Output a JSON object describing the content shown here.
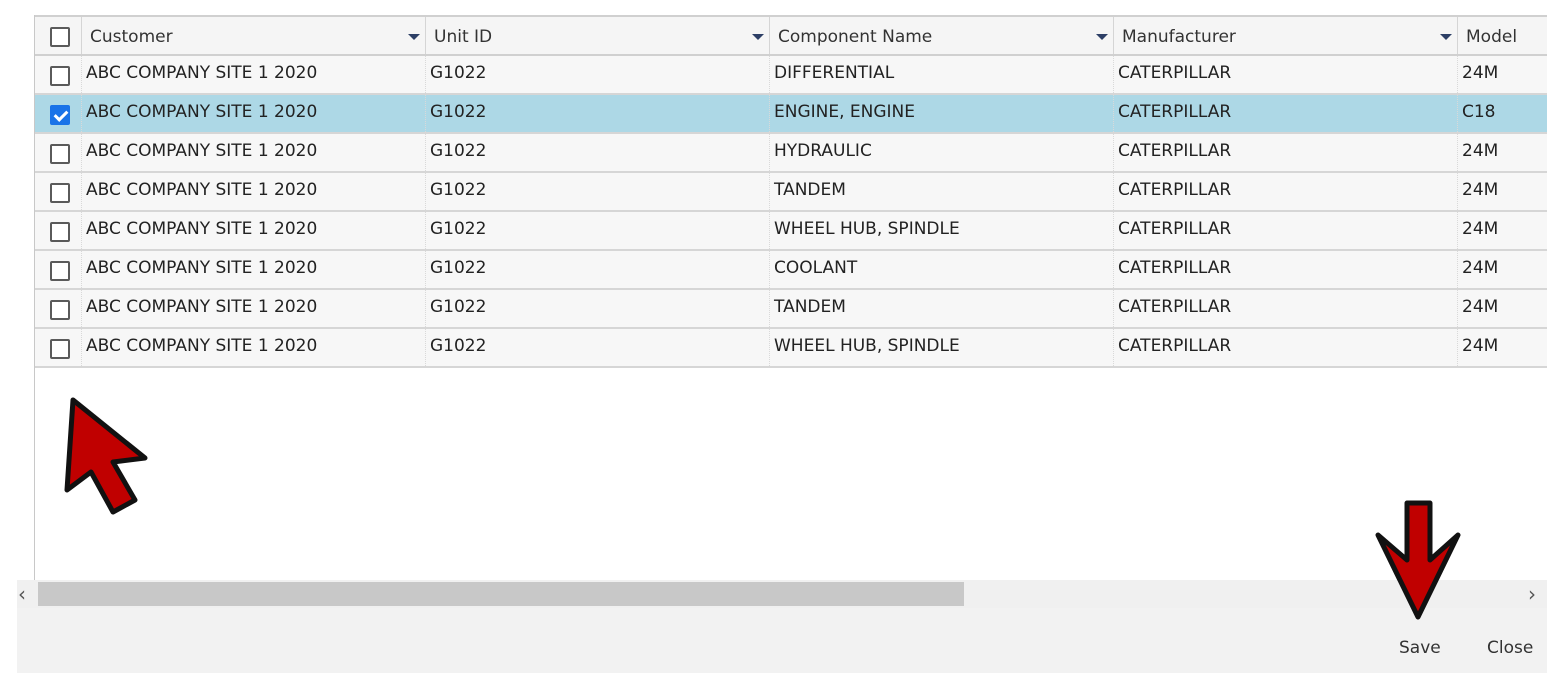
{
  "grid": {
    "columns": [
      {
        "key": "customer",
        "label": "Customer"
      },
      {
        "key": "unit_id",
        "label": "Unit ID"
      },
      {
        "key": "component",
        "label": "Component Name"
      },
      {
        "key": "manufacturer",
        "label": "Manufacturer"
      },
      {
        "key": "model",
        "label": "Model"
      }
    ],
    "rows": [
      {
        "customer": "ABC COMPANY SITE 1 2020",
        "unit_id": "G1022",
        "component": "DIFFERENTIAL",
        "manufacturer": "CATERPILLAR",
        "model": "24M",
        "checked": false
      },
      {
        "customer": "ABC COMPANY SITE 1 2020",
        "unit_id": "G1022",
        "component": "ENGINE, ENGINE",
        "manufacturer": "CATERPILLAR",
        "model": "C18",
        "checked": true
      },
      {
        "customer": "ABC COMPANY SITE 1 2020",
        "unit_id": "G1022",
        "component": "HYDRAULIC",
        "manufacturer": "CATERPILLAR",
        "model": "24M",
        "checked": false
      },
      {
        "customer": "ABC COMPANY SITE 1 2020",
        "unit_id": "G1022",
        "component": "TANDEM",
        "manufacturer": "CATERPILLAR",
        "model": "24M",
        "checked": false
      },
      {
        "customer": "ABC COMPANY SITE 1 2020",
        "unit_id": "G1022",
        "component": "WHEEL HUB, SPINDLE",
        "manufacturer": "CATERPILLAR",
        "model": "24M",
        "checked": false
      },
      {
        "customer": "ABC COMPANY SITE 1 2020",
        "unit_id": "G1022",
        "component": "COOLANT",
        "manufacturer": "CATERPILLAR",
        "model": "24M",
        "checked": false
      },
      {
        "customer": "ABC COMPANY SITE 1 2020",
        "unit_id": "G1022",
        "component": "TANDEM",
        "manufacturer": "CATERPILLAR",
        "model": "24M",
        "checked": false
      },
      {
        "customer": "ABC COMPANY SITE 1 2020",
        "unit_id": "G1022",
        "component": "WHEEL HUB, SPINDLE",
        "manufacturer": "CATERPILLAR",
        "model": "24M",
        "checked": false
      }
    ],
    "header_checked": false,
    "selected_row_color": "#add8e6"
  },
  "scrollbar": {
    "left_icon": "chevron-left-icon",
    "right_icon": "chevron-right-icon",
    "left_glyph": "‹",
    "right_glyph": "›"
  },
  "footer": {
    "save_label": "Save",
    "close_label": "Close"
  },
  "annotations": {
    "arrow_color": "#c00000",
    "arrows": [
      {
        "name": "annotation-arrow-up-left",
        "points_to": "row checkbox"
      },
      {
        "name": "annotation-arrow-down",
        "points_to": "Save button"
      }
    ]
  }
}
